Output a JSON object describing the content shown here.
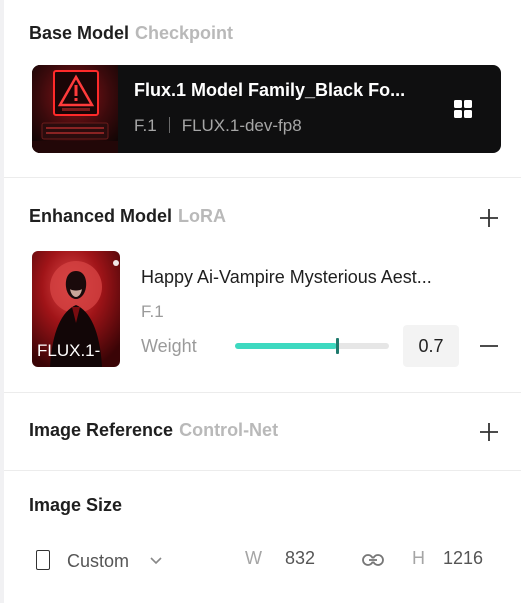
{
  "base_model": {
    "title": "Base Model",
    "subtitle": "Checkpoint",
    "card": {
      "name": "Flux.1 Model Family_Black Fo...",
      "version": "F.1",
      "variant": "FLUX.1-dev-fp8"
    }
  },
  "enhanced_model": {
    "title": "Enhanced Model",
    "subtitle": "LoRA",
    "lora": {
      "name": "Happy Ai-Vampire Mysterious Aest...",
      "version": "F.1",
      "badge": "FLUX.1-",
      "weight_label": "Weight",
      "weight_value": "0.7",
      "slider_fraction": 0.66
    }
  },
  "image_reference": {
    "title": "Image Reference",
    "subtitle": "Control-Net"
  },
  "image_size": {
    "title": "Image Size",
    "preset": "Custom",
    "width_label": "W",
    "width_value": "832",
    "height_label": "H",
    "height_value": "1216"
  },
  "colors": {
    "accent": "#3dd9c0",
    "muted": "#b9b9b9"
  }
}
